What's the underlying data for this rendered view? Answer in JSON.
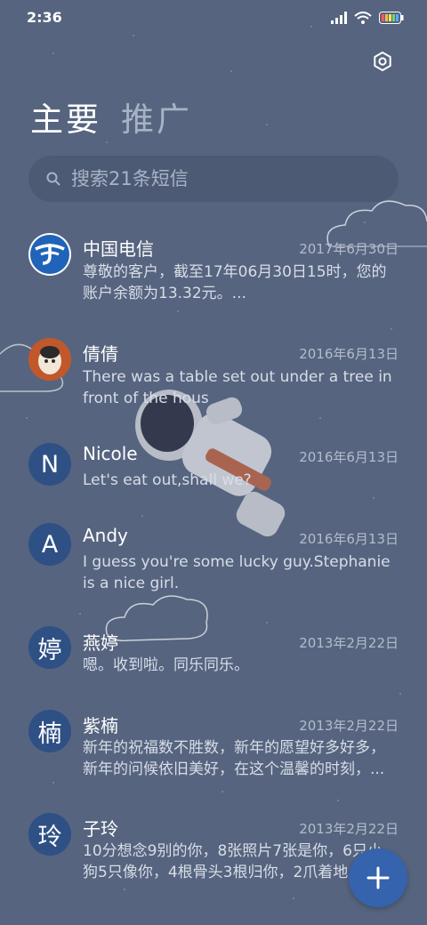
{
  "status": {
    "time": "2:36"
  },
  "tabs": [
    {
      "label": "主要"
    },
    {
      "label": "推广"
    }
  ],
  "search": {
    "placeholder": "搜索21条短信"
  },
  "conversations": [
    {
      "name": "中国电信",
      "date": "2017年6月30日",
      "preview": "尊敬的客户，截至17年06月30日15时，您的账户余额为13.32元。...",
      "avatar": "",
      "avatar_icon": "china-telecom-logo-icon"
    },
    {
      "name": "倩倩",
      "date": "2016年6月13日",
      "preview": "There was a table set out under a tree in front of the hous",
      "avatar": "",
      "avatar_icon": "photo-avatar-icon"
    },
    {
      "name": "Nicole",
      "date": "2016年6月13日",
      "preview": "Let's eat out,shall we?",
      "avatar": "N"
    },
    {
      "name": "Andy",
      "date": "2016年6月13日",
      "preview": "I guess you're some lucky guy.Stephanie is a nice girl.",
      "avatar": "A"
    },
    {
      "name": "燕婷",
      "date": "2013年2月22日",
      "preview": "嗯。收到啦。同乐同乐。",
      "avatar": "婷"
    },
    {
      "name": "紫楠",
      "date": "2013年2月22日",
      "preview": "新年的祝福数不胜数，新年的愿望好多好多，新年的问候依旧美好，在这个温馨的时刻，...",
      "avatar": "楠"
    },
    {
      "name": "子玲",
      "date": "2013年2月22日",
      "preview": "10分想念9别的你，8张照片7张是你，6只小狗5只像你，4根骨头3根归你，2爪着地",
      "avatar": "玲"
    }
  ],
  "colors": {
    "background": "#56647f",
    "avatar": "#2e5085",
    "fab": "#3563ad"
  },
  "icons": {
    "settings": "gear-icon",
    "search": "search-icon",
    "fab": "plus-icon"
  }
}
